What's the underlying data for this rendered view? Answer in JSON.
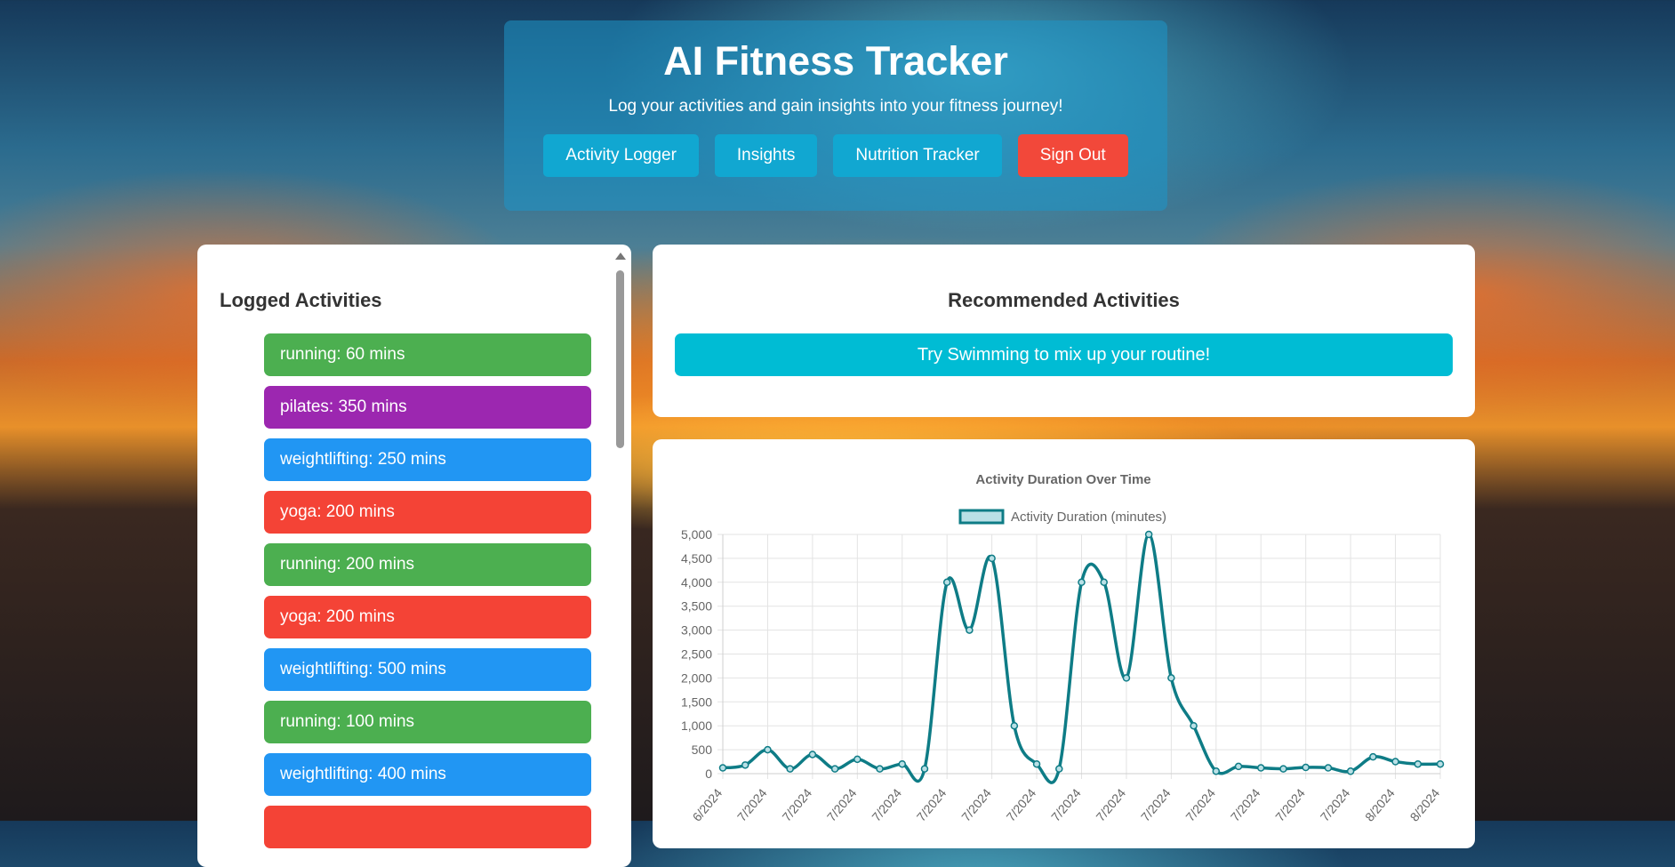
{
  "header": {
    "title": "AI Fitness Tracker",
    "subtitle": "Log your activities and gain insights into your fitness journey!",
    "nav": [
      {
        "label": "Activity Logger"
      },
      {
        "label": "Insights"
      },
      {
        "label": "Nutrition Tracker"
      },
      {
        "label": "Sign Out"
      }
    ]
  },
  "activities": {
    "title": "Logged Activities",
    "items": [
      {
        "label": "running: 60 mins",
        "color": "#4caf50"
      },
      {
        "label": "pilates: 350 mins",
        "color": "#9c27b0"
      },
      {
        "label": "weightlifting: 250 mins",
        "color": "#2196f3"
      },
      {
        "label": "yoga: 200 mins",
        "color": "#f44336"
      },
      {
        "label": "running: 200 mins",
        "color": "#4caf50"
      },
      {
        "label": "yoga: 200 mins",
        "color": "#f44336"
      },
      {
        "label": "weightlifting: 500 mins",
        "color": "#2196f3"
      },
      {
        "label": "running: 100 mins",
        "color": "#4caf50"
      },
      {
        "label": "weightlifting: 400 mins",
        "color": "#2196f3"
      },
      {
        "label": "",
        "color": "#f44336"
      }
    ]
  },
  "recommendations": {
    "title": "Recommended Activities",
    "items": [
      "Try Swimming to mix up your routine!"
    ]
  },
  "chart_data": {
    "type": "line",
    "title": "Activity Duration Over Time",
    "series": [
      {
        "name": "Activity Duration (minutes)",
        "color": "#0e7c86",
        "fill": "#b9e0e6",
        "values": [
          120,
          180,
          500,
          100,
          400,
          100,
          300,
          100,
          200,
          100,
          4000,
          3000,
          4500,
          1000,
          200,
          100,
          4000,
          4000,
          2000,
          5000,
          2000,
          1000,
          50,
          150,
          120,
          100,
          130,
          120,
          50,
          350,
          250,
          200,
          200
        ]
      }
    ],
    "x_tick_labels": [
      "6/2024",
      "7/2024",
      "7/2024",
      "7/2024",
      "7/2024",
      "7/2024",
      "7/2024",
      "7/2024",
      "7/2024",
      "7/2024",
      "7/2024",
      "7/2024",
      "7/2024",
      "7/2024",
      "7/2024",
      "8/2024",
      "8/2024"
    ],
    "y_ticks": [
      0,
      500,
      1000,
      1500,
      2000,
      2500,
      3000,
      3500,
      4000,
      4500,
      5000
    ],
    "y_tick_labels": [
      "0",
      "500",
      "1,000",
      "1,500",
      "2,000",
      "2,500",
      "3,000",
      "3,500",
      "4,000",
      "4,500",
      "5,000"
    ],
    "ylim": [
      0,
      5000
    ],
    "grid": true,
    "legend": "top-center"
  }
}
